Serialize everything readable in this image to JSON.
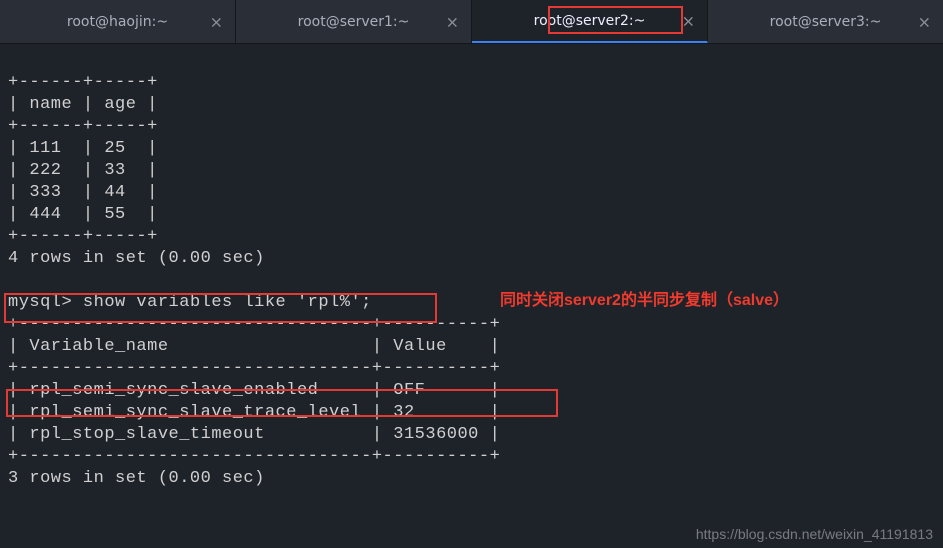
{
  "tabs": {
    "t0": {
      "label": "root@haojin:~"
    },
    "t1": {
      "label": "root@server1:~"
    },
    "t2": {
      "label": "root@server2:~"
    },
    "t3": {
      "label": "root@server3:~"
    }
  },
  "table1": {
    "border_top": "+------+-----+",
    "header": "| name | age |",
    "border_mid": "+------+-----+",
    "r0": "| 111  | 25  |",
    "r1": "| 222  | 33  |",
    "r2": "| 333  | 44  |",
    "r3": "| 444  | 55  |",
    "border_bot": "+------+-----+",
    "summary": "4 rows in set (0.00 sec)"
  },
  "cmd": {
    "prompt": "mysql> ",
    "text": "show variables like 'rpl%';"
  },
  "table2": {
    "border_top": "+---------------------------------+----------+",
    "header": "| Variable_name                   | Value    |",
    "border_mid": "+---------------------------------+----------+",
    "r0": "| rpl_semi_sync_slave_enabled     | OFF      |",
    "r1": "| rpl_semi_sync_slave_trace_level | 32       |",
    "r2": "| rpl_stop_slave_timeout          | 31536000 |",
    "border_bot": "+---------------------------------+----------+",
    "summary": "3 rows in set (0.00 sec)"
  },
  "annotation": "同时关闭server2的半同步复制（salve）",
  "watermark": "https://blog.csdn.net/weixin_41191813"
}
